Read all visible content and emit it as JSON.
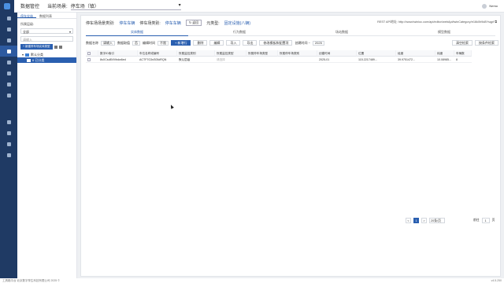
{
  "topbar": {
    "app_title": "数据管控",
    "scene_label": "当前场景:",
    "scene_value": "停车场（镇）",
    "user_name": "Nemo"
  },
  "leftnav": {
    "icons": [
      "settings-icon",
      "grid-icon",
      "network-icon",
      "data-icon",
      "user-icon",
      "sync-icon",
      "book-icon",
      "star-icon",
      "lock-icon",
      "globe-icon",
      "doc-icon",
      "tool-icon"
    ]
  },
  "panel": {
    "tabs": [
      "停车实体",
      "数据列表"
    ],
    "active_tab": 0,
    "filter_label": "所属层级:",
    "filter_value": "全部",
    "search_placeholder": "请输入",
    "add_button": "+ 新建停车场实体类型",
    "tree": [
      {
        "label": "默认分类",
        "level": 0,
        "selected": false
      },
      {
        "label": "6 已分类",
        "level": 1,
        "selected": true
      }
    ]
  },
  "main": {
    "crumb": {
      "part1": "停车场场景类别:",
      "part2": "停车车辆",
      "part3": "停车场类别:",
      "part4": "停车车辆",
      "back": "返回",
      "part5": "元类型:",
      "part6": "固定设施(八辆)"
    },
    "api_url": "REST API地址: http://www.twinioc.com/api/editor/webApi/twinCategory/e16k0h9d8Ysqpf",
    "tabs": [
      "实体数据",
      "行为数据",
      "场站数据",
      "模型数据"
    ],
    "active_tab": 0,
    "toolbar": {
      "filter_label": "数据名称",
      "filter_value": "请输入",
      "cond_label": "数据取值",
      "cond_value": "否",
      "sort_label": "编辑时间",
      "sort_value": "不限",
      "add_button": "+ 新增行",
      "delete_button": "删除",
      "edit_button": "编辑",
      "import_button": "导入",
      "export_button": "导出",
      "template_button": "修改模板和配置项",
      "time_label": "创建时间 ~",
      "time_value": "2025",
      "reset_button": "清空检索",
      "search_button": "按条件检索"
    },
    "columns": [
      "",
      "数字ID索引",
      "车位名称或编号",
      "所属监控类别",
      "所属监控类型",
      "所属停车场类型",
      "所属停车场类别",
      "创建时间",
      "位置",
      "经度",
      "纬度",
      "车辆数"
    ],
    "rows": [
      [
        "",
        "8sXCsd8ViVbdw6ed",
        "ACTF7G3sS05dRQN",
        "默认层级",
        "请选择",
        "",
        "",
        "2025-01",
        "115.2217489...",
        "39.9751472...",
        "10.08985...",
        "8"
      ]
    ],
    "extra_col_header": "编号",
    "extra_col_value": "0",
    "pager": {
      "prev": "<",
      "current": "1",
      "next": ">",
      "per_page": "20条/页",
      "goto_label": "前往",
      "goto_value": "1",
      "page_unit": "页"
    }
  },
  "footer": {
    "left": "工具箱平台 北京数字孪生科技有限公司 2025 ©",
    "right": "v4.5.250"
  }
}
